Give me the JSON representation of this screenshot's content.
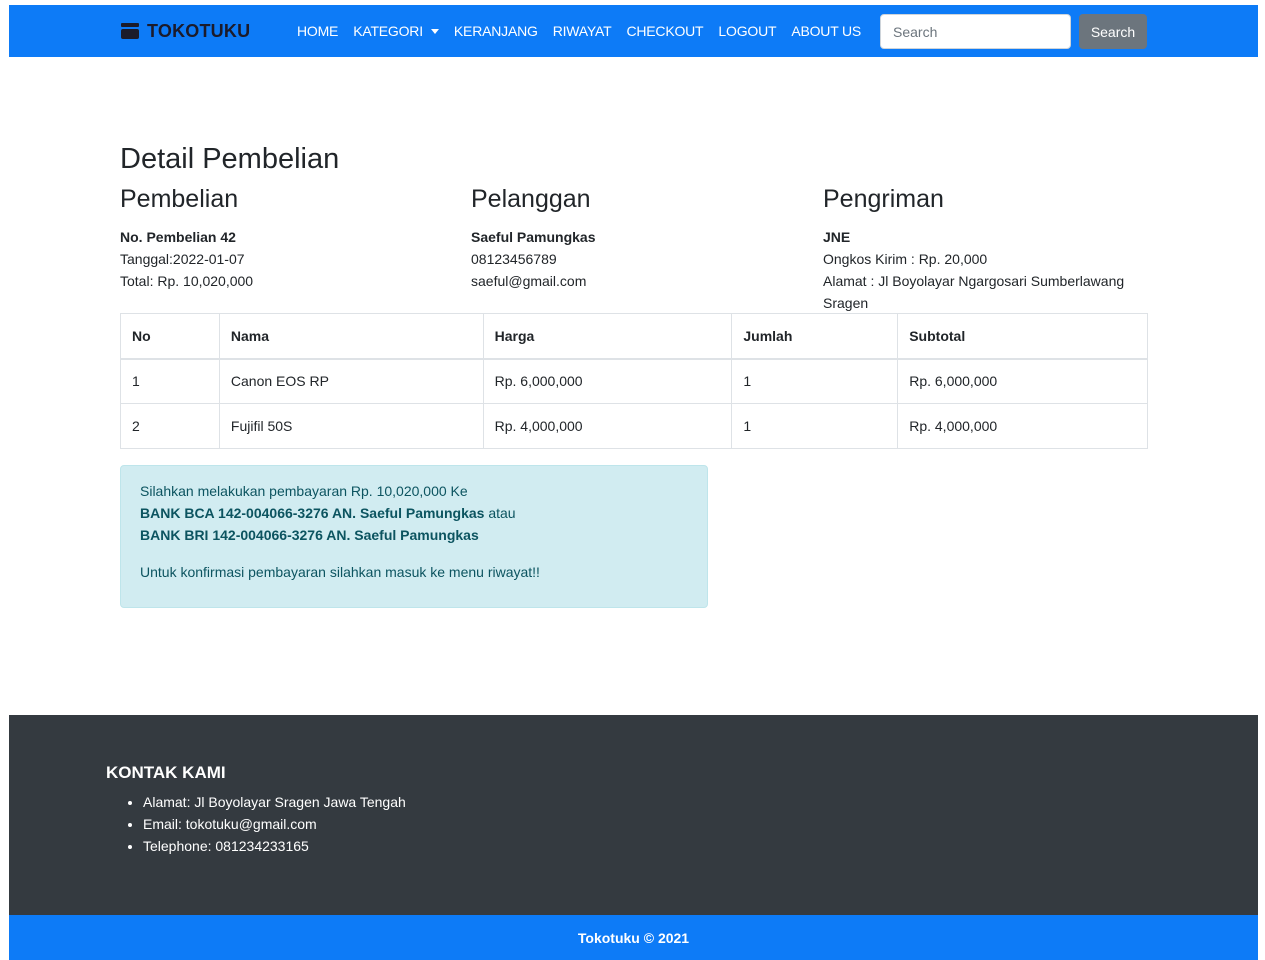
{
  "navbar": {
    "brand": "TOKOTUKU",
    "links": [
      "HOME",
      "KATEGORI",
      "KERANJANG",
      "RIWAYAT",
      "CHECKOUT",
      "LOGOUT",
      "ABOUT US"
    ],
    "search_placeholder": "Search",
    "search_button": "Search"
  },
  "page": {
    "title": "Detail Pembelian"
  },
  "pembelian": {
    "heading": "Pembelian",
    "number": "No. Pembelian 42",
    "date": "Tanggal:2022-01-07",
    "total": "Total: Rp. 10,020,000"
  },
  "pelanggan": {
    "heading": "Pelanggan",
    "name": "Saeful Pamungkas",
    "phone": "08123456789",
    "email": "saeful@gmail.com"
  },
  "pengiriman": {
    "heading": "Pengriman",
    "courier": "JNE",
    "cost": "Ongkos Kirim : Rp. 20,000",
    "address": "Alamat : Jl Boyolayar Ngargosari Sumberlawang Sragen"
  },
  "table": {
    "headers": [
      "No",
      "Nama",
      "Harga",
      "Jumlah",
      "Subtotal"
    ],
    "rows": [
      [
        "1",
        "Canon EOS RP",
        "Rp. 6,000,000",
        "1",
        "Rp. 6,000,000"
      ],
      [
        "2",
        "Fujifil 50S",
        "Rp. 4,000,000",
        "1",
        "Rp. 4,000,000"
      ]
    ]
  },
  "alert": {
    "line1": "Silahkan melakukan pembayaran Rp. 10,020,000 Ke",
    "bank1": "BANK BCA 142-004066-3276 AN. Saeful Pamungkas",
    "or": " atau",
    "bank2": "BANK BRI 142-004066-3276 AN. Saeful Pamungkas",
    "confirm": "Untuk konfirmasi pembayaran silahkan masuk ke menu riwayat!!"
  },
  "footer": {
    "heading": "KONTAK KAMI",
    "items": [
      "Alamat: Jl Boyolayar Sragen Jawa Tengah",
      "Email: tokotuku@gmail.com",
      "Telephone: 081234233165"
    ],
    "copyright": "Tokotuku © 2021"
  }
}
